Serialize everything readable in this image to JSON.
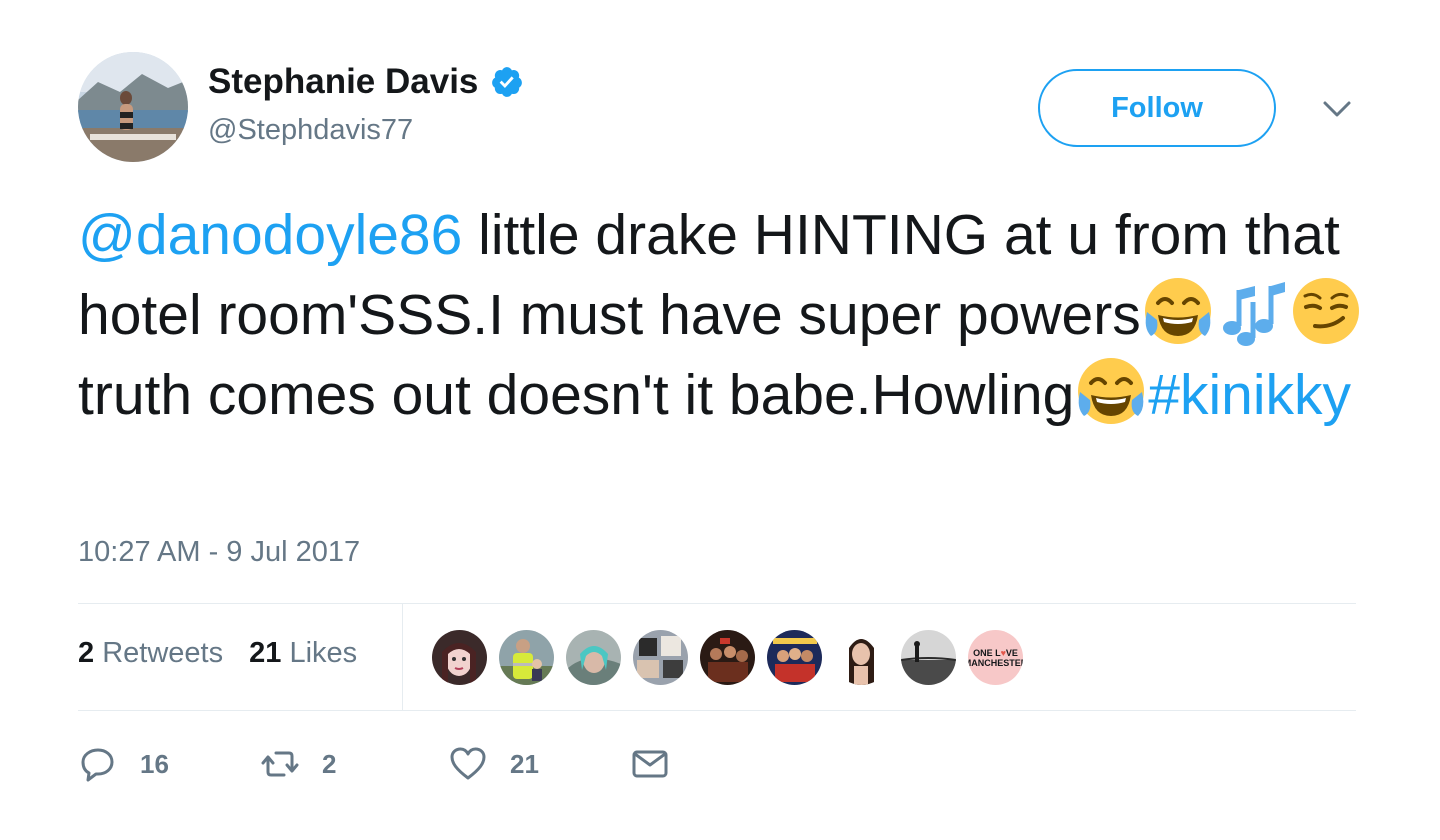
{
  "header": {
    "name": "Stephanie Davis",
    "handle": "@Stephdavis77",
    "follow_label": "Follow",
    "verified_icon": "verified-badge-icon"
  },
  "tweet": {
    "mention": "@danodoyle86",
    "text_1": " little drake HINTING at u from that hotel room'SSS.I must have super powers",
    "text_2": " truth comes out doesn't it babe.Howling",
    "hashtag": "#kinikky",
    "emojis": [
      "face-with-tears-of-joy",
      "musical-notes",
      "smirking-face",
      "face-with-tears-of-joy"
    ]
  },
  "timestamp": "10:27 AM - 9 Jul 2017",
  "stats": {
    "retweets_count": "2",
    "retweets_label": "Retweets",
    "likes_count": "21",
    "likes_label": "Likes"
  },
  "likers_last_badge": [
    "ONE L",
    "VE",
    "MANCHESTER"
  ],
  "actions": {
    "reply_count": "16",
    "retweet_count": "2",
    "like_count": "21"
  },
  "colors": {
    "accent": "#1da1f2",
    "secondary_text": "#657786",
    "primary_text": "#14171a",
    "divider": "#e6ecf0"
  }
}
